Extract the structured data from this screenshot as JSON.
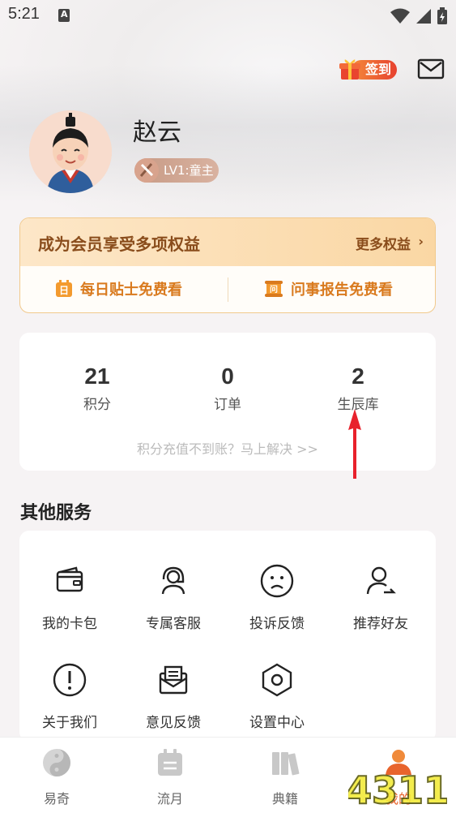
{
  "status_bar": {
    "time": "5:21"
  },
  "header": {
    "signin_label": "签到"
  },
  "profile": {
    "name": "赵云",
    "level": "LV1:童主"
  },
  "member": {
    "title": "成为会员享受多项权益",
    "more": "更多权益",
    "perks": [
      "每日贴士免费看",
      "问事报告免费看"
    ]
  },
  "stats": {
    "items": [
      {
        "value": "21",
        "label": "积分"
      },
      {
        "value": "0",
        "label": "订单"
      },
      {
        "value": "2",
        "label": "生辰库"
      }
    ],
    "hint": "积分充值不到账？马上解决 >>"
  },
  "services": {
    "title": "其他服务",
    "items": [
      {
        "label": "我的卡包",
        "icon": "wallet-icon"
      },
      {
        "label": "专属客服",
        "icon": "headset-icon"
      },
      {
        "label": "投诉反馈",
        "icon": "sad-face-icon"
      },
      {
        "label": "推荐好友",
        "icon": "share-user-icon"
      },
      {
        "label": "关于我们",
        "icon": "info-alert-icon"
      },
      {
        "label": "意见反馈",
        "icon": "feedback-mail-icon"
      },
      {
        "label": "设置中心",
        "icon": "settings-hex-icon"
      }
    ]
  },
  "nav": {
    "items": [
      {
        "label": "易奇",
        "icon": "yinyang-icon"
      },
      {
        "label": "流月",
        "icon": "calendar-icon"
      },
      {
        "label": "典籍",
        "icon": "books-icon"
      },
      {
        "label": "我的",
        "icon": "profile-icon"
      }
    ]
  },
  "watermark": {
    "text": "4311"
  },
  "colors": {
    "accent": "#e8642c",
    "gold": "#8a4d1c",
    "orange": "#d97a1e"
  }
}
